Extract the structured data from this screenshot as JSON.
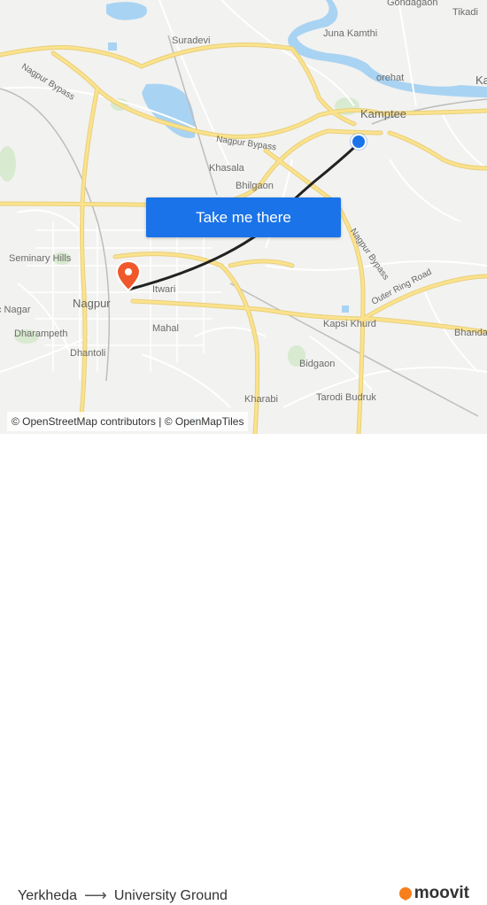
{
  "map": {
    "place_labels": [
      {
        "key": "gondagaon",
        "text": "Gondagaon"
      },
      {
        "key": "tikadi",
        "text": "Tikadi"
      },
      {
        "key": "suradevi",
        "text": "Suradevi"
      },
      {
        "key": "juna_kamthi",
        "text": "Juna Kamthi"
      },
      {
        "key": "orehat",
        "text": "orehat"
      },
      {
        "key": "ka",
        "text": "Ka"
      },
      {
        "key": "kamptee",
        "text": "Kamptee"
      },
      {
        "key": "khasala",
        "text": "Khasala"
      },
      {
        "key": "bhilgaon",
        "text": "Bhilgaon"
      },
      {
        "key": "seminary_hills",
        "text": "Seminary Hills"
      },
      {
        "key": "nagar",
        "text": "c Nagar"
      },
      {
        "key": "nagpur",
        "text": "Nagpur"
      },
      {
        "key": "itwari",
        "text": "Itwari"
      },
      {
        "key": "dharampeth",
        "text": "Dharampeth"
      },
      {
        "key": "mahal",
        "text": "Mahal"
      },
      {
        "key": "dhantoli",
        "text": "Dhantoli"
      },
      {
        "key": "kapsi_khurd",
        "text": "Kapsi Khurd"
      },
      {
        "key": "bhanda",
        "text": "Bhanda"
      },
      {
        "key": "bidgaon",
        "text": "Bidgaon"
      },
      {
        "key": "kharabi",
        "text": "Kharabi"
      },
      {
        "key": "tarodi_budruk",
        "text": "Tarodi Budruk"
      }
    ],
    "road_labels": [
      {
        "key": "nagpur_bypass_1",
        "text": "Nagpur Bypass"
      },
      {
        "key": "nagpur_bypass_2",
        "text": "Nagpur Bypass"
      },
      {
        "key": "nagpur_bypass_3",
        "text": "Nagpur Bypass"
      },
      {
        "key": "outer_ring_road",
        "text": "Outer Ring Road"
      }
    ],
    "cta_label": "Take me there",
    "attribution": "© OpenStreetMap contributors | © OpenMapTiles",
    "colors": {
      "route": "#222222",
      "origin": "#1a73e8",
      "destination": "#f0582b",
      "water": "#a9d3f2",
      "roads_major": "#fbe28d",
      "button": "#1a73e8"
    },
    "markers": {
      "origin_icon": "origin-dot-icon",
      "destination_icon": "map-pin-icon"
    }
  },
  "footer": {
    "origin": "Yerkheda",
    "destination": "University Ground",
    "arrow_icon": "arrow-right-icon",
    "brand": "moovit"
  }
}
